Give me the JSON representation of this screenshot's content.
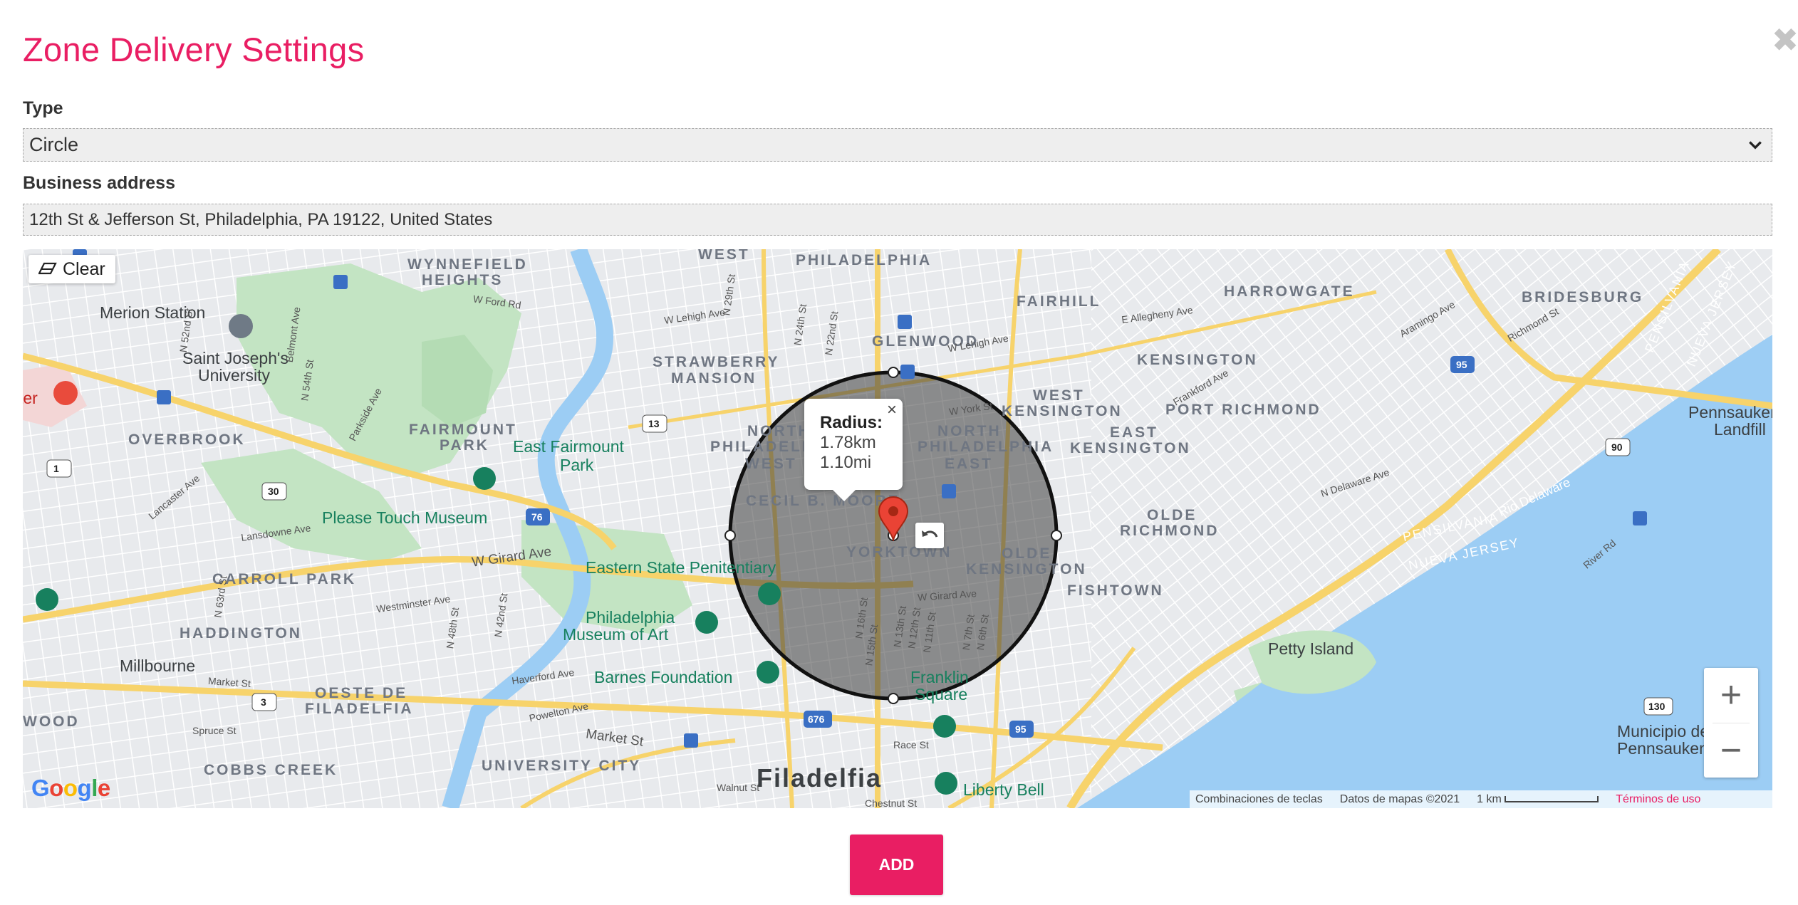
{
  "dialog": {
    "title": "Zone Delivery Settings",
    "close_symbol": "✖"
  },
  "form": {
    "type_label": "Type",
    "type_value": "Circle",
    "address_label": "Business address",
    "address_value": "12th St & Jefferson St, Philadelphia, PA 19122, United States"
  },
  "map": {
    "clear_label": "Clear",
    "radius_popup": {
      "label": "Radius:",
      "km": "1.78km",
      "mi": "1.10mi",
      "close_symbol": "×"
    },
    "zoom_in": "+",
    "zoom_out": "−",
    "attribution": {
      "shortcuts": "Combinaciones de teclas",
      "data": "Datos de mapas ©2021",
      "scale": "1 km",
      "terms": "Términos de uso"
    },
    "logo": "Google",
    "districts": [
      "WEST",
      "PHILADELPHIA",
      "WYNNEFIELD",
      "HEIGHTS",
      "FAIRHILL",
      "HARROWGATE",
      "BRIDESBURG",
      "GLENWOOD",
      "STRAWBERRY",
      "MANSION",
      "KENSINGTON",
      "PORT RICHMOND",
      "FAIRMOUNT",
      "PARK",
      "OVERBROOK",
      "NORTH",
      "PHILADELPHIA",
      "WEST",
      "NORTH",
      "PHILADELPHIA",
      "EAST",
      "WEST",
      "KENSINGTON",
      "EAST",
      "KENSINGTON",
      "CECIL B. MOORE",
      "OLDE",
      "RICHMOND",
      "CARROLL PARK",
      "YORKTOWN",
      "OLDE",
      "KENSINGTON",
      "FISHTOWN",
      "HADDINGTON",
      "OESTE DE",
      "FILADELFIA",
      "COBBS CREEK",
      "UNIVERSITY CITY",
      "WOOD"
    ],
    "places": [
      "Merion Station",
      "Saint Joseph's",
      "University",
      "East Fairmount",
      "Park",
      "Please Touch Museum",
      "Eastern State Penitentiary",
      "Philadelphia",
      "Museum of Art",
      "Barnes Foundation",
      "Franklin",
      "Square",
      "Liberty Bell",
      "Millbourne",
      "Petty Island",
      "Pennsauken",
      "Landfill",
      "Municipio de",
      "Pennsauken",
      "Filadelfia",
      "PENSILVANIA",
      "NUEVA JERSEY",
      "PENSILVANIA",
      "NUEVA JERSEY",
      "Rio Delaware",
      "ter"
    ],
    "streets": [
      "W Lehigh Ave",
      "W Girard Ave",
      "W Girard Ave",
      "Market St",
      "Market St",
      "Race St",
      "Walnut St",
      "Spruce St",
      "Chestnut St",
      "Haverford Ave",
      "Powelton Ave",
      "Lansdowne Ave",
      "Westminster Ave",
      "Lancaster Ave",
      "W York St",
      "W Lehigh Ave",
      "E Allegheny Ave",
      "Aramingo Ave",
      "Frankford Ave",
      "N Delaware Ave",
      "Richmond St",
      "River Rd",
      "N 29th St",
      "N 24th St",
      "N 22nd St",
      "N 16th St",
      "N 15th St",
      "N 13th St",
      "N 12th St",
      "N 11th St",
      "N 7th St",
      "N 6th St",
      "N 52nd St",
      "N 54th St",
      "N 42nd St",
      "N 48th St",
      "N 63rd St",
      "W Ford Rd",
      "Parkside Ave",
      "Belmont Ave"
    ],
    "route_shields": [
      "1",
      "30",
      "13",
      "3",
      "76",
      "676",
      "95",
      "95",
      "90",
      "130"
    ]
  },
  "actions": {
    "add_label": "ADD"
  },
  "colors": {
    "accent": "#e91e63",
    "water": "#9ccdf4",
    "park": "#c3e4c3",
    "highway": "#f7d36b",
    "circle_fill": "#3c3c3c"
  }
}
